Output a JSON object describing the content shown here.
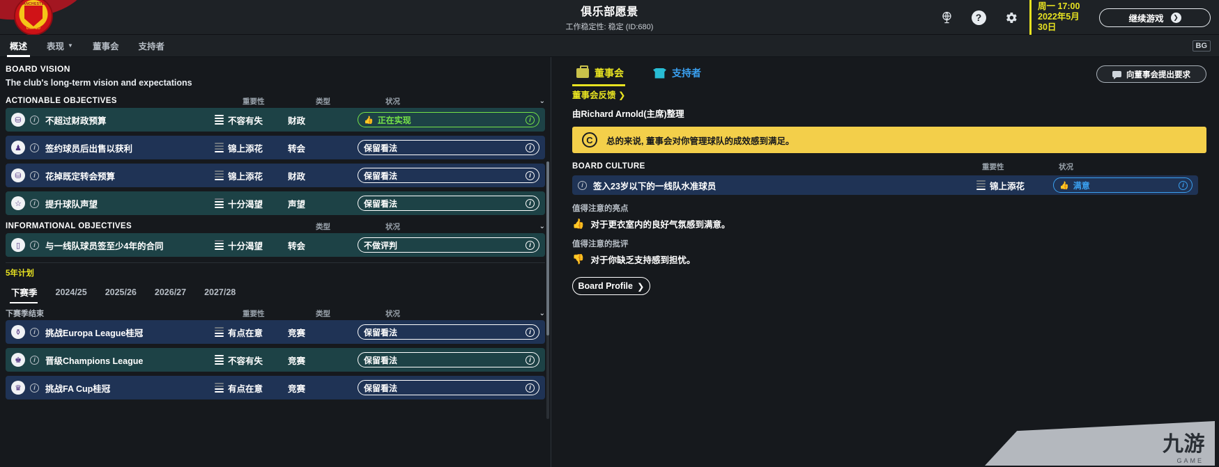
{
  "header": {
    "club": "Manchester United",
    "crest_top": "MANCHESTER",
    "crest_bottom": "UNITED",
    "title": "俱乐部愿景",
    "subtitle": "工作稳定性: 稳定 (ID:680)",
    "icons": {
      "globe": "globe-icon",
      "help": "?",
      "settings": "gear-icon"
    },
    "date_line1": "周一 17:00",
    "date_line2": "2022年5月30日",
    "continue_label": "继续游戏",
    "continue_arrow": "❯"
  },
  "nav": {
    "items": [
      {
        "label": "概述",
        "active": true,
        "caret": false
      },
      {
        "label": "表现",
        "active": false,
        "caret": true
      },
      {
        "label": "董事会",
        "active": false,
        "caret": false
      },
      {
        "label": "支持者",
        "active": false,
        "caret": false
      }
    ],
    "badge": "BG"
  },
  "left": {
    "board_vision_title": "BOARD VISION",
    "board_vision_sub": "The club's long-term vision and expectations",
    "actionable_header": {
      "label": "ACTIONABLE OBJECTIVES",
      "col_importance": "重要性",
      "col_type": "类型",
      "col_status": "状况",
      "chevron": "⌄"
    },
    "actionable_rows": [
      {
        "icon": "coins-icon",
        "glyph": "⛁",
        "name": "不超过财政预算",
        "importance": "不容有失",
        "imp_level": 4,
        "type": "财政",
        "status": "正在实现",
        "status_style": "green",
        "status_icon": "👍",
        "row_style": "teal"
      },
      {
        "icon": "player-icon",
        "glyph": "♟",
        "name": "签约球员后出售以获利",
        "importance": "锦上添花",
        "imp_level": 1,
        "type": "转会",
        "status": "保留看法",
        "status_style": "white",
        "status_icon": "",
        "row_style": "navy"
      },
      {
        "icon": "coins-icon",
        "glyph": "⛁",
        "name": "花掉既定转会预算",
        "importance": "锦上添花",
        "imp_level": 1,
        "type": "财政",
        "status": "保留看法",
        "status_style": "white",
        "status_icon": "",
        "row_style": "navy"
      },
      {
        "icon": "star-icon",
        "glyph": "☆",
        "name": "提升球队声望",
        "importance": "十分渴望",
        "imp_level": 3,
        "type": "声望",
        "status": "保留看法",
        "status_style": "white",
        "status_icon": "",
        "row_style": "teal"
      }
    ],
    "informational_header": {
      "label": "INFORMATIONAL OBJECTIVES",
      "col_importance": "",
      "col_type": "类型",
      "col_status": "状况",
      "chevron": "⌄"
    },
    "informational_rows": [
      {
        "icon": "contract-icon",
        "glyph": "▯",
        "name": "与一线队球员签至少4年的合同",
        "importance": "十分渴望",
        "imp_level": 3,
        "type": "转会",
        "status": "不做评判",
        "status_style": "white",
        "status_icon": "",
        "row_style": "teal"
      }
    ],
    "five_year_label": "5年计划",
    "season_tabs": [
      {
        "label": "下赛季",
        "active": true
      },
      {
        "label": "2024/25",
        "active": false
      },
      {
        "label": "2025/26",
        "active": false
      },
      {
        "label": "2026/27",
        "active": false
      },
      {
        "label": "2027/28",
        "active": false
      }
    ],
    "plan_header": {
      "label": "下赛季结束",
      "col_importance": "重要性",
      "col_type": "类型",
      "col_status": "状况",
      "chevron": "⌄"
    },
    "plan_rows": [
      {
        "icon": "europa-league-icon",
        "glyph": "⚱",
        "name": "挑战Europa League桂冠",
        "importance": "有点在意",
        "imp_level": 2,
        "type": "竞赛",
        "status": "保留看法",
        "status_style": "white",
        "status_icon": "",
        "row_style": "navy"
      },
      {
        "icon": "premier-league-icon",
        "glyph": "♚",
        "name": "晋级Champions League",
        "importance": "不容有失",
        "imp_level": 4,
        "type": "竞赛",
        "status": "保留看法",
        "status_style": "white",
        "status_icon": "",
        "row_style": "teal"
      },
      {
        "icon": "fa-cup-icon",
        "glyph": "♛",
        "name": "挑战FA Cup桂冠",
        "importance": "有点在意",
        "imp_level": 2,
        "type": "竞赛",
        "status": "保留看法",
        "status_style": "white",
        "status_icon": "",
        "row_style": "navy"
      }
    ]
  },
  "right": {
    "tabs": [
      {
        "label": "董事会",
        "icon": "briefcase-icon",
        "active": true
      },
      {
        "label": "支持者",
        "icon": "shirt-icon",
        "active": false
      }
    ],
    "demand_button": "向董事会提出要求",
    "feedback_link": "董事会反馈 ❯",
    "compiled_by": "由Richard Arnold(主席)整理",
    "banner_grade": "C",
    "banner_text": "总的来说, 董事会对你管理球队的成效感到满足。",
    "board_culture_title": "BOARD CULTURE",
    "bc_col_importance": "重要性",
    "bc_col_status": "状况",
    "culture_rows": [
      {
        "name": "签入23岁以下的一线队水准球员",
        "importance": "锦上添花",
        "imp_level": 1,
        "status": "满意",
        "status_style": "blue",
        "status_icon": "👍"
      }
    ],
    "highlights_label": "值得注意的亮点",
    "highlights_text": "对于更衣室内的良好气氛感到满意。",
    "criticism_label": "值得注意的批评",
    "criticism_text": "对于你缺乏支持感到担忧。",
    "profile_button": "Board Profile",
    "profile_arrow": "❯"
  },
  "watermark": {
    "text": "九游",
    "sub": "GAME"
  },
  "colors": {
    "accent_yellow": "#e8e321",
    "accent_blue": "#3aa0f0",
    "accent_green": "#76e348",
    "row_teal": "#1d4246",
    "row_navy": "#1f3355",
    "bg": "#16191d",
    "topbar": "#1e2226"
  }
}
